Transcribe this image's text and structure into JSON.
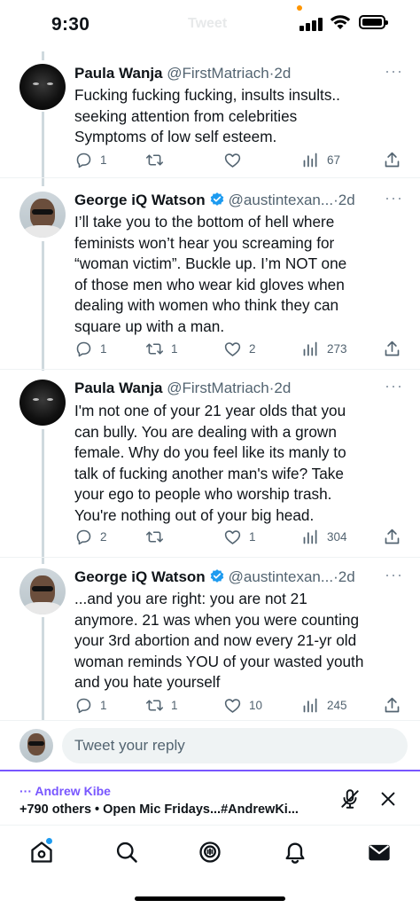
{
  "status_bar": {
    "time": "9:30",
    "ghost_title": "Tweet"
  },
  "tweets": [
    {
      "name": "Paula Wanja",
      "handle": "@FirstMatriach",
      "sep": "·",
      "time": "2d",
      "verified": false,
      "lines": [
        "Fucking fucking fucking, insults insults..",
        "seeking attention from celebrities",
        "Symptoms of low self esteem."
      ],
      "replies": "1",
      "retweets": "",
      "likes": "",
      "views": "67"
    },
    {
      "name": "George iQ Watson",
      "handle": "@austintexan...",
      "sep": "·",
      "time": "2d",
      "verified": true,
      "lines": [
        "I’ll take you to the bottom of hell where",
        "feminists won’t hear you screaming for",
        "“woman victim”. Buckle up. I’m NOT one",
        "of those men who wear kid gloves when",
        "dealing with women who think they can",
        "square up with a man."
      ],
      "replies": "1",
      "retweets": "1",
      "likes": "2",
      "views": "273"
    },
    {
      "name": "Paula Wanja",
      "handle": "@FirstMatriach",
      "sep": "·",
      "time": "2d",
      "verified": false,
      "lines": [
        "I'm not one of your 21 year olds that you",
        "can bully. You are dealing with a grown",
        "female. Why do you feel like its manly to",
        "talk of fucking another man's wife? Take",
        "your ego to people who worship trash.",
        "You're nothing out of your big head."
      ],
      "replies": "2",
      "retweets": "",
      "likes": "1",
      "views": "304"
    },
    {
      "name": "George iQ Watson",
      "handle": "@austintexan...",
      "sep": "·",
      "time": "2d",
      "verified": true,
      "lines": [
        "...and you are right: you are not 21",
        "anymore. 21 was when you were counting",
        "your 3rd abortion and now every 21-yr old",
        "woman reminds YOU of your wasted youth",
        "and you hate yourself"
      ],
      "replies": "1",
      "retweets": "1",
      "likes": "10",
      "views": "245"
    }
  ],
  "reply": {
    "placeholder": "Tweet your reply"
  },
  "space": {
    "host": "··· Andrew Kibe",
    "info": "+790 others • Open Mic Fridays...#AndrewKi..."
  },
  "colors": {
    "space_accent": "#7856ff",
    "verified": "#1d9bf0",
    "muted": "#536471"
  },
  "icons": {
    "tabs": [
      "home-icon",
      "search-icon",
      "spaces-icon",
      "notifications-icon",
      "messages-icon"
    ],
    "actions": [
      "reply-icon",
      "retweet-icon",
      "like-icon",
      "views-icon",
      "share-icon"
    ]
  }
}
